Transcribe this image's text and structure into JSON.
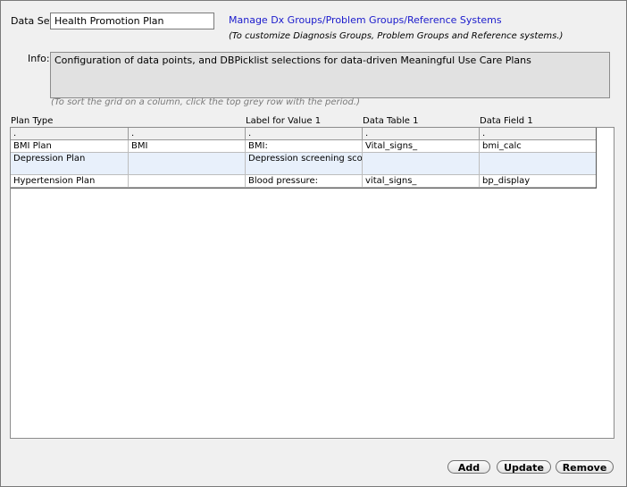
{
  "dataset": {
    "label": "Data Set:",
    "value": "Health Promotion Plan"
  },
  "manage_link": "Manage Dx Groups/Problem Groups/Reference Systems",
  "manage_hint": "(To customize Diagnosis Groups, Problem Groups and Reference systems.)",
  "info": {
    "label": "Info:",
    "text": "Configuration of data points, and DBPicklist selections for data-driven Meaningful Use Care Plans"
  },
  "sort_hint": "(To sort the grid on a column, click the top grey row with the period.)",
  "columns": {
    "plan_type": "Plan Type",
    "label_value_1": "Label for Value 1",
    "data_table_1": "Data Table 1",
    "data_field_1": "Data Field 1"
  },
  "sort_row": [
    ".",
    ".",
    ".",
    ".",
    "."
  ],
  "rows": [
    [
      "BMI Plan",
      "BMI",
      "BMI:",
      "Vital_signs_",
      "bmi_calc"
    ],
    [
      "Depression Plan",
      "",
      "Depression screening score:",
      "",
      ""
    ],
    [
      "Hypertension Plan",
      "",
      "Blood pressure:",
      "vital_signs_",
      "bp_display"
    ]
  ],
  "buttons": {
    "add": "Add",
    "update": "Update",
    "remove": "Remove"
  }
}
